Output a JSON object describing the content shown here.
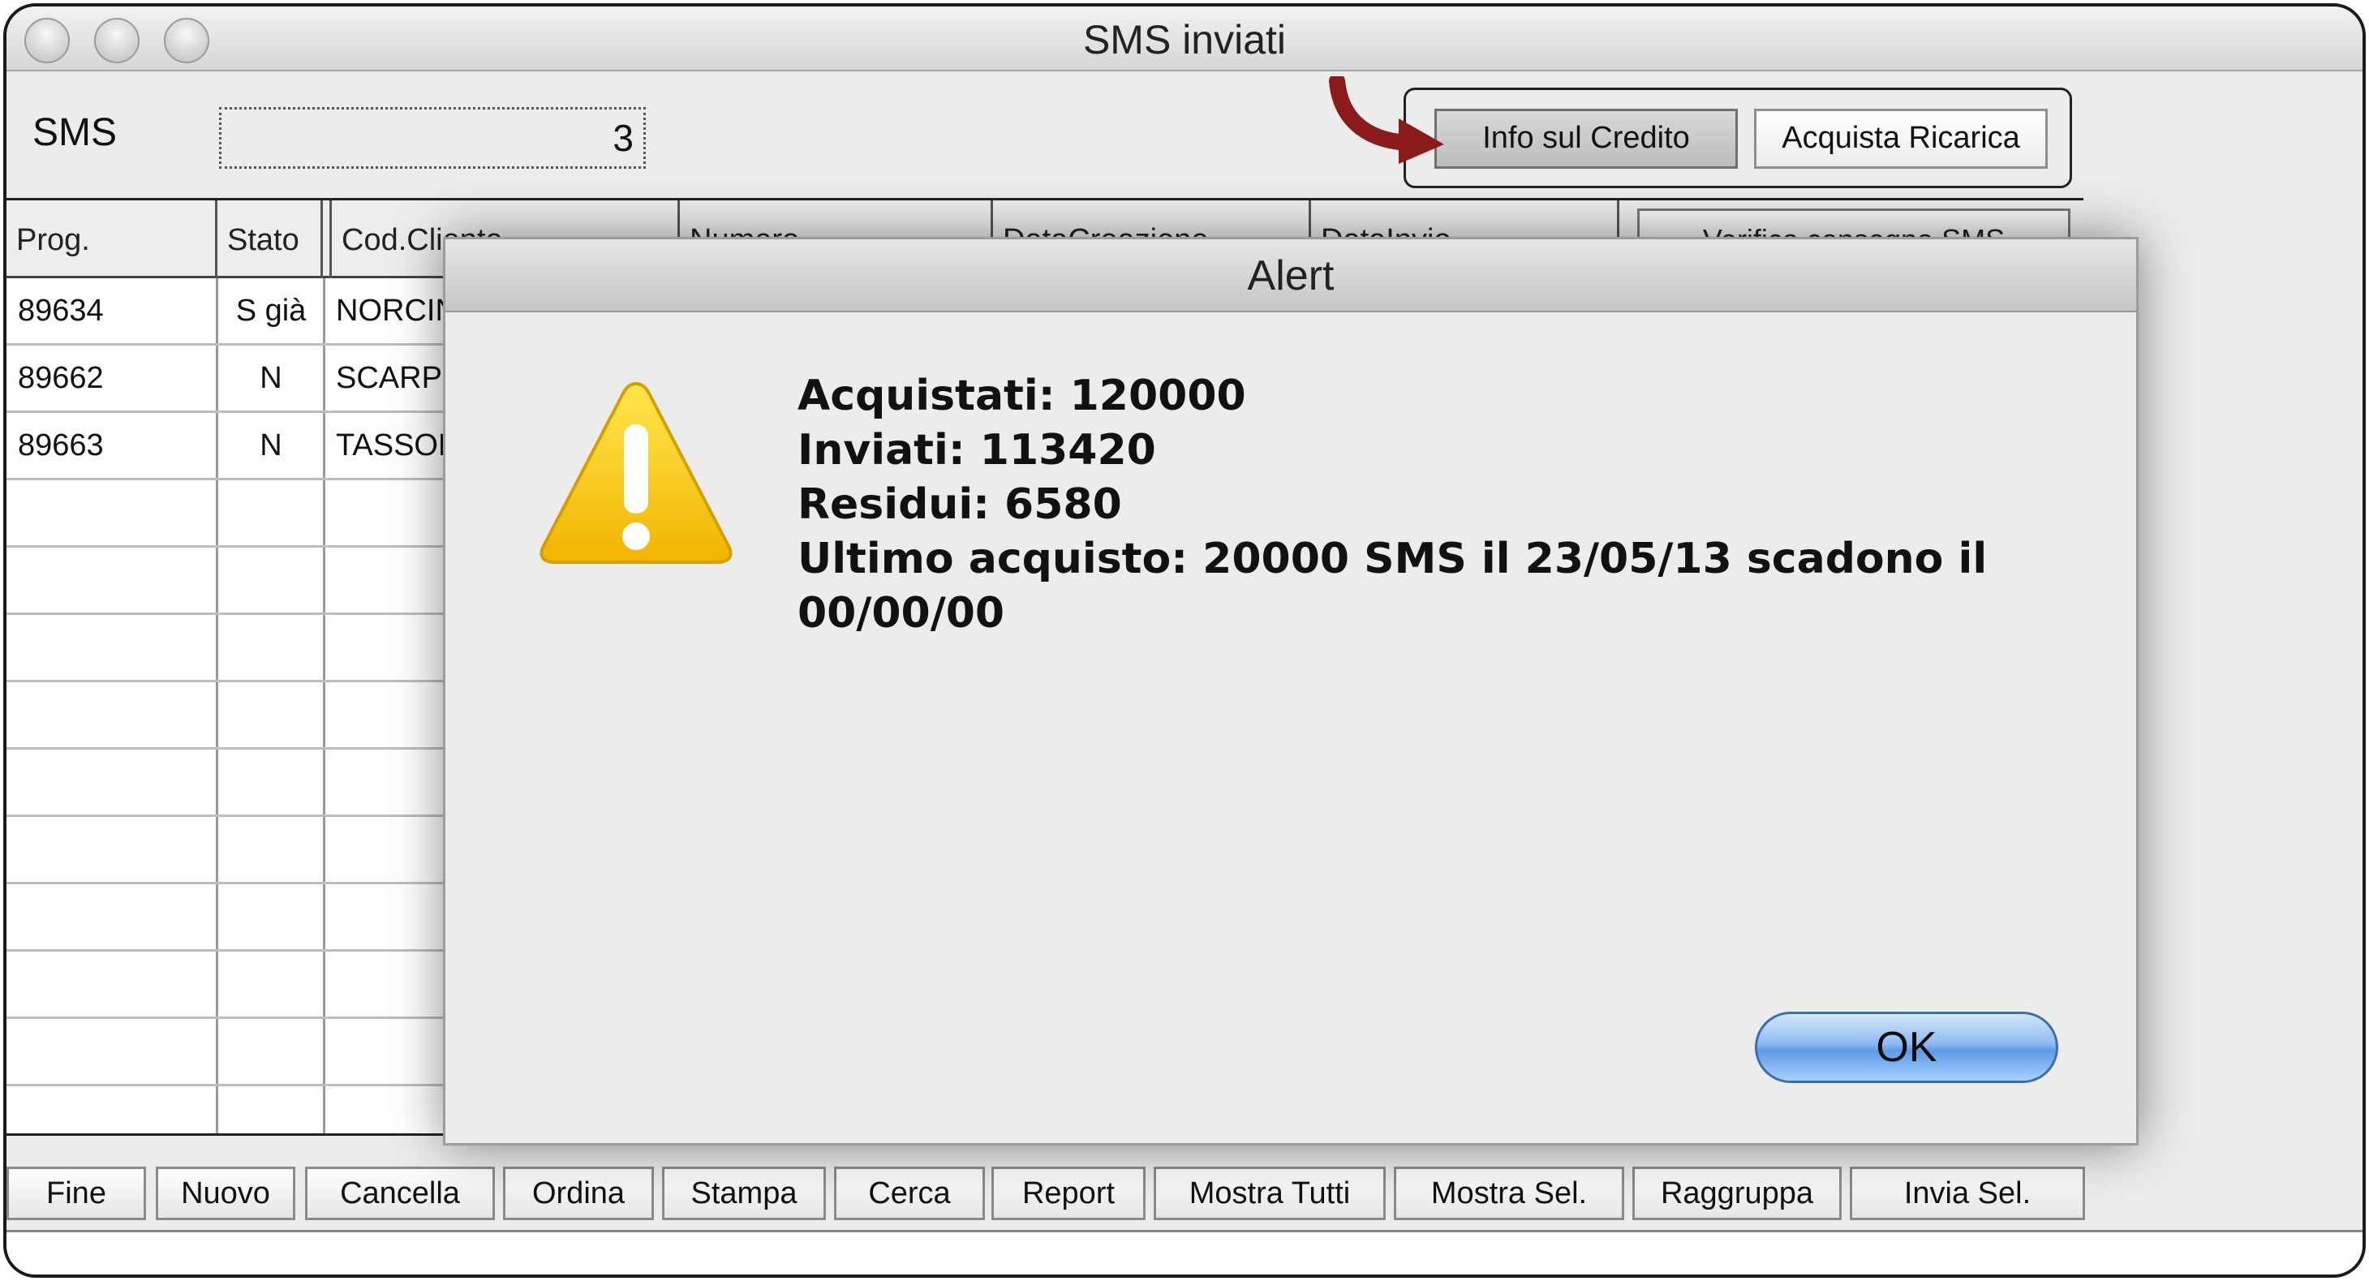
{
  "window": {
    "title": "SMS inviati"
  },
  "header": {
    "sms_label": "SMS",
    "sms_count": "3",
    "info_credito_label": "Info sul Credito",
    "acquista_ricarica_label": "Acquista Ricarica"
  },
  "table": {
    "columns": [
      "Prog.",
      "Stato",
      "Cod.Cliente",
      "Numero",
      "DataCreazione",
      "DataInvio"
    ],
    "verify_button_label": "Verifica consegna SMS",
    "rows": [
      {
        "prog": "89634",
        "stato": "S già",
        "cliente": "NORCINI"
      },
      {
        "prog": "89662",
        "stato": "N",
        "cliente": "SCARPE"
      },
      {
        "prog": "89663",
        "stato": "N",
        "cliente": "TASSON"
      }
    ]
  },
  "footer": {
    "buttons": [
      "Fine",
      "Nuovo",
      "Cancella",
      "Ordina",
      "Stampa",
      "Cerca",
      "Report",
      "Mostra Tutti",
      "Mostra Sel.",
      "Raggruppa",
      "Invia Sel."
    ]
  },
  "dialog": {
    "title": "Alert",
    "lines": [
      "Acquistati: 120000",
      "Inviati: 113420",
      "Residui: 6580",
      "Ultimo acquisto: 20000 SMS il 23/05/13 scadono il",
      "00/00/00"
    ],
    "ok_label": "OK",
    "icon": "warning-icon"
  },
  "colors": {
    "arrow": "#8b1a1a",
    "ok_button": "#5d9be6",
    "warning": "#f5c400"
  }
}
